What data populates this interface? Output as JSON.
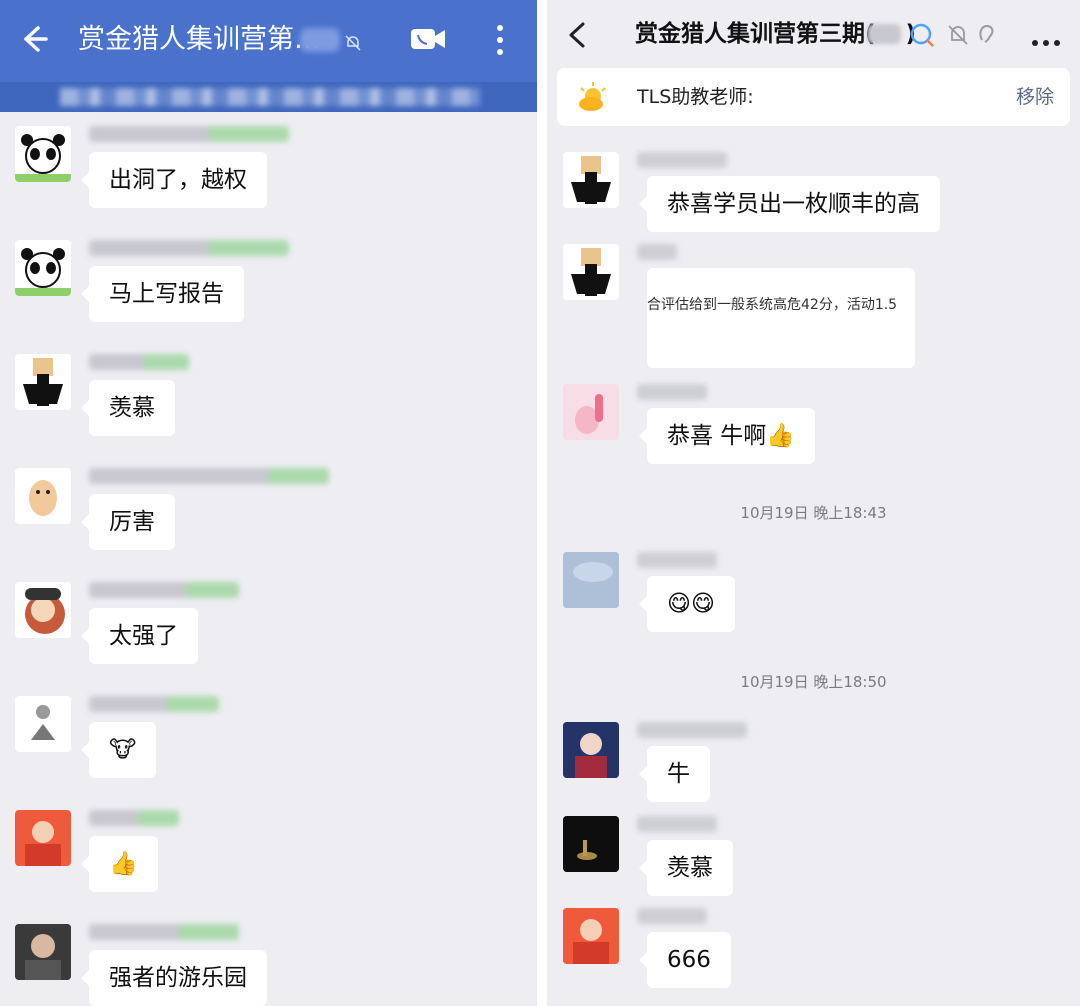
{
  "left": {
    "header": {
      "title": "赏金猎人集训营第…",
      "back_icon": "arrow-left-icon",
      "mute_icon": "bell-off-icon",
      "video_icon": "video-camera-icon",
      "more_icon": "more-vertical-icon"
    },
    "messages": [
      {
        "text": "出洞了，越权",
        "avatar": "panda"
      },
      {
        "text": "马上写报告",
        "avatar": "panda"
      },
      {
        "text": "羡慕",
        "avatar": "dog"
      },
      {
        "text": "厉害",
        "avatar": "cat"
      },
      {
        "text": "太强了",
        "avatar": "cartoon"
      },
      {
        "text": "🐮",
        "avatar": "gray"
      },
      {
        "text": "👍",
        "avatar": "red"
      },
      {
        "text": "强者的游乐园",
        "avatar": "dark"
      }
    ]
  },
  "right": {
    "header": {
      "title": "赏金猎人集训营第三期(",
      "title_suffix": ")",
      "back_icon": "chevron-left-icon",
      "ai_icon": "chat-search-icon",
      "mute_icon": "bell-off-icon",
      "ear_icon": "ear-icon",
      "more_icon": "more-horizontal-icon"
    },
    "pinned": {
      "text": "TLS助教老师:",
      "action": "移除",
      "icon": "sun-cloud-icon"
    },
    "messages": [
      {
        "text": "恭喜学员出一枚顺丰的高"
      },
      {
        "preview_text": "合评估给到一般系统高危42分，活动1.5"
      },
      {
        "text": "恭喜 牛啊👍"
      },
      {
        "timestamp": "10月19日 晚上18:43"
      },
      {
        "text": "😋😋"
      },
      {
        "timestamp": "10月19日 晚上18:50"
      },
      {
        "text": "牛"
      },
      {
        "text": "羡慕"
      },
      {
        "text": "666"
      }
    ]
  }
}
